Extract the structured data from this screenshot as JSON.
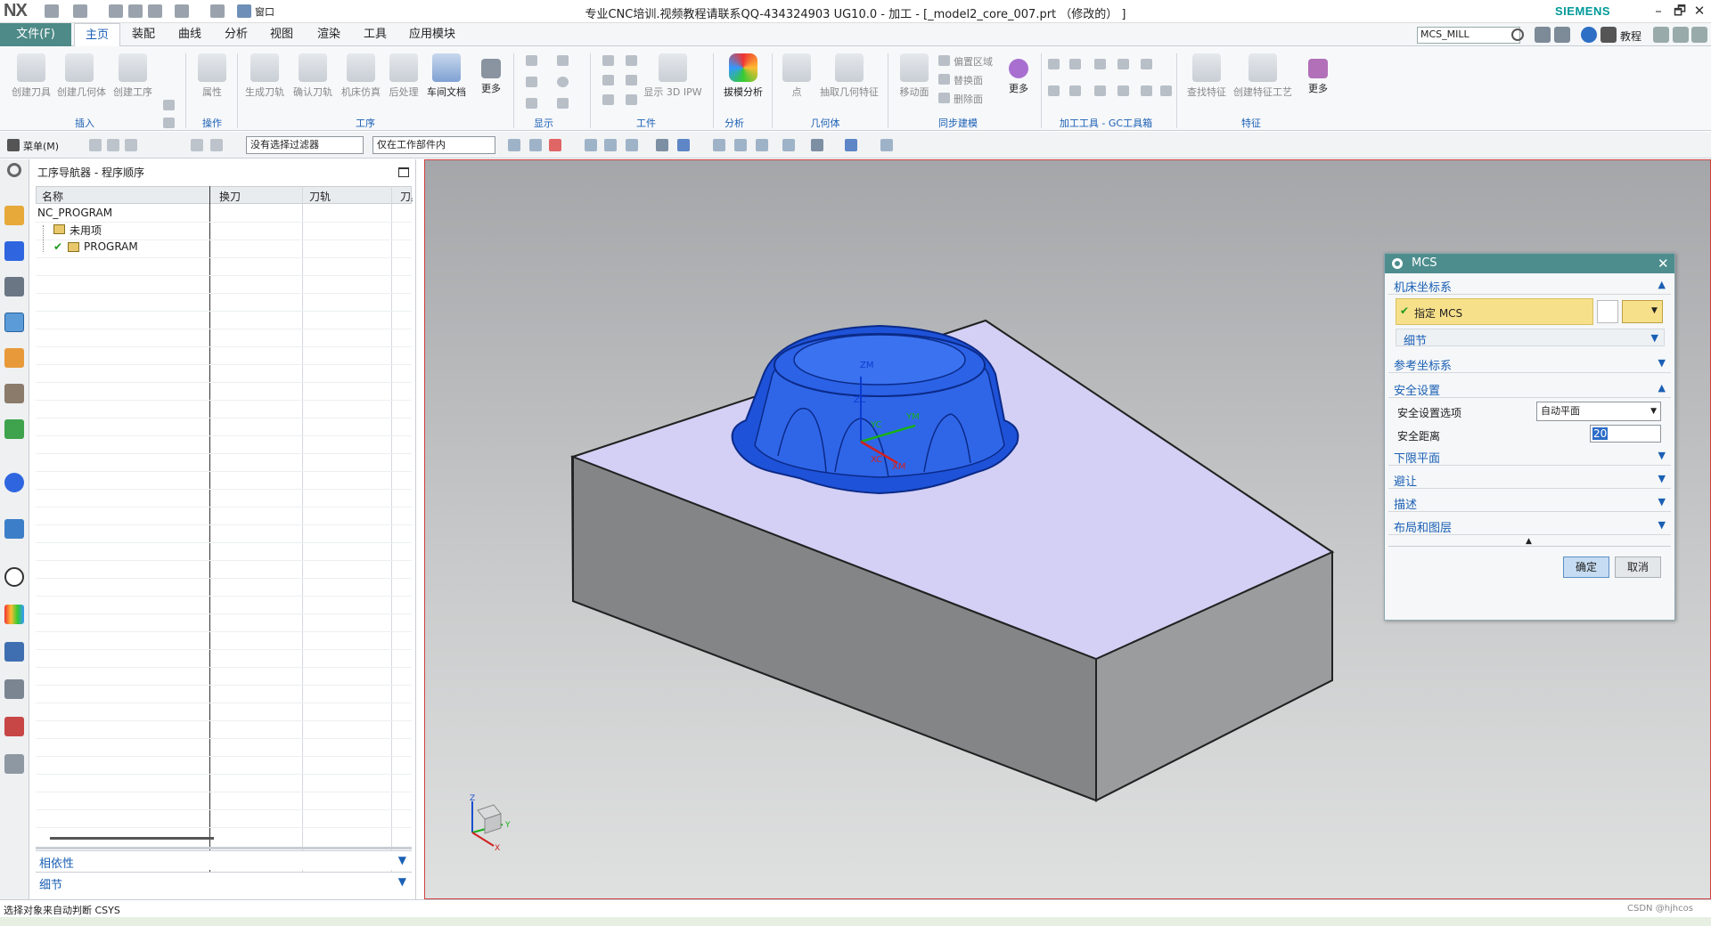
{
  "titlebar": {
    "logo": "NX",
    "title": "专业CNC培训.视频教程请联系QQ-434324903 UG10.0 - 加工 - [_model2_core_007.prt （修改的） ]",
    "brand": "SIEMENS",
    "window_menu": "窗口",
    "min": "–",
    "restore": "🗗",
    "close": "✕"
  },
  "menubar": {
    "file": "文件(F)",
    "tabs": [
      "主页",
      "装配",
      "曲线",
      "分析",
      "视图",
      "渲染",
      "工具",
      "应用模块"
    ],
    "search_value": "MCS_MILL",
    "tutorial": "教程"
  },
  "ribbon": {
    "buttons": [
      "创建刀具",
      "创建几何体",
      "创建工序",
      "属性",
      "生成刀轨",
      "确认刀轨",
      "机床仿真",
      "后处理",
      "车间文档",
      "更多",
      "显示 3D IPW",
      "拔模分析",
      "点",
      "抽取几何特征",
      "移动面",
      "更多",
      "查找特征",
      "创建特征工艺",
      "更多"
    ],
    "small": [
      "偏置区域",
      "替换面",
      "删除面"
    ],
    "groups": [
      "插入",
      "操作",
      "工序",
      "显示",
      "工件",
      "分析",
      "几何体",
      "同步建模",
      "加工工具 - GC工具箱",
      "特征"
    ]
  },
  "toolbar2": {
    "menu": "菜单(M)",
    "filter": "没有选择过滤器",
    "scope": "仅在工作部件内"
  },
  "navigator": {
    "title": "工序导航器 - 程序顺序",
    "columns": [
      "名称",
      "换刀",
      "刀轨",
      "刀具"
    ],
    "tree": [
      {
        "label": "NC_PROGRAM"
      },
      {
        "label": "未用项"
      },
      {
        "label": "PROGRAM"
      }
    ],
    "dependencies": "相依性",
    "details": "细节"
  },
  "viewport": {
    "labels": {
      "zm": "ZM",
      "zc": "ZC",
      "yc": "YC",
      "ym": "YM",
      "xc": "XC",
      "xm": "XM"
    },
    "triad": {
      "z": "Z",
      "y": "Y",
      "x": "X"
    }
  },
  "dialog": {
    "title": "MCS",
    "sections": {
      "machine_csys": "机床坐标系",
      "specify_mcs": "指定 MCS",
      "details": "细节",
      "ref_csys": "参考坐标系",
      "safety": "安全设置",
      "safety_option_label": "安全设置选项",
      "safety_option_value": "自动平面",
      "safety_distance_label": "安全距离",
      "safety_distance_value": "20",
      "lower_plane": "下限平面",
      "avoidance": "避让",
      "description": "描述",
      "layout_layer": "布局和图层"
    },
    "ok": "确定",
    "cancel": "取消"
  },
  "status": {
    "text": "选择对象来自动判断 CSYS",
    "watermark": "CSDN @hjhcos"
  },
  "colors": {
    "accent": "#4d8a88",
    "link": "#1a5fb4",
    "part_blue": "#2f66e0",
    "block_top": "#d2cdf2",
    "dialog_highlight": "#f7e08a"
  }
}
